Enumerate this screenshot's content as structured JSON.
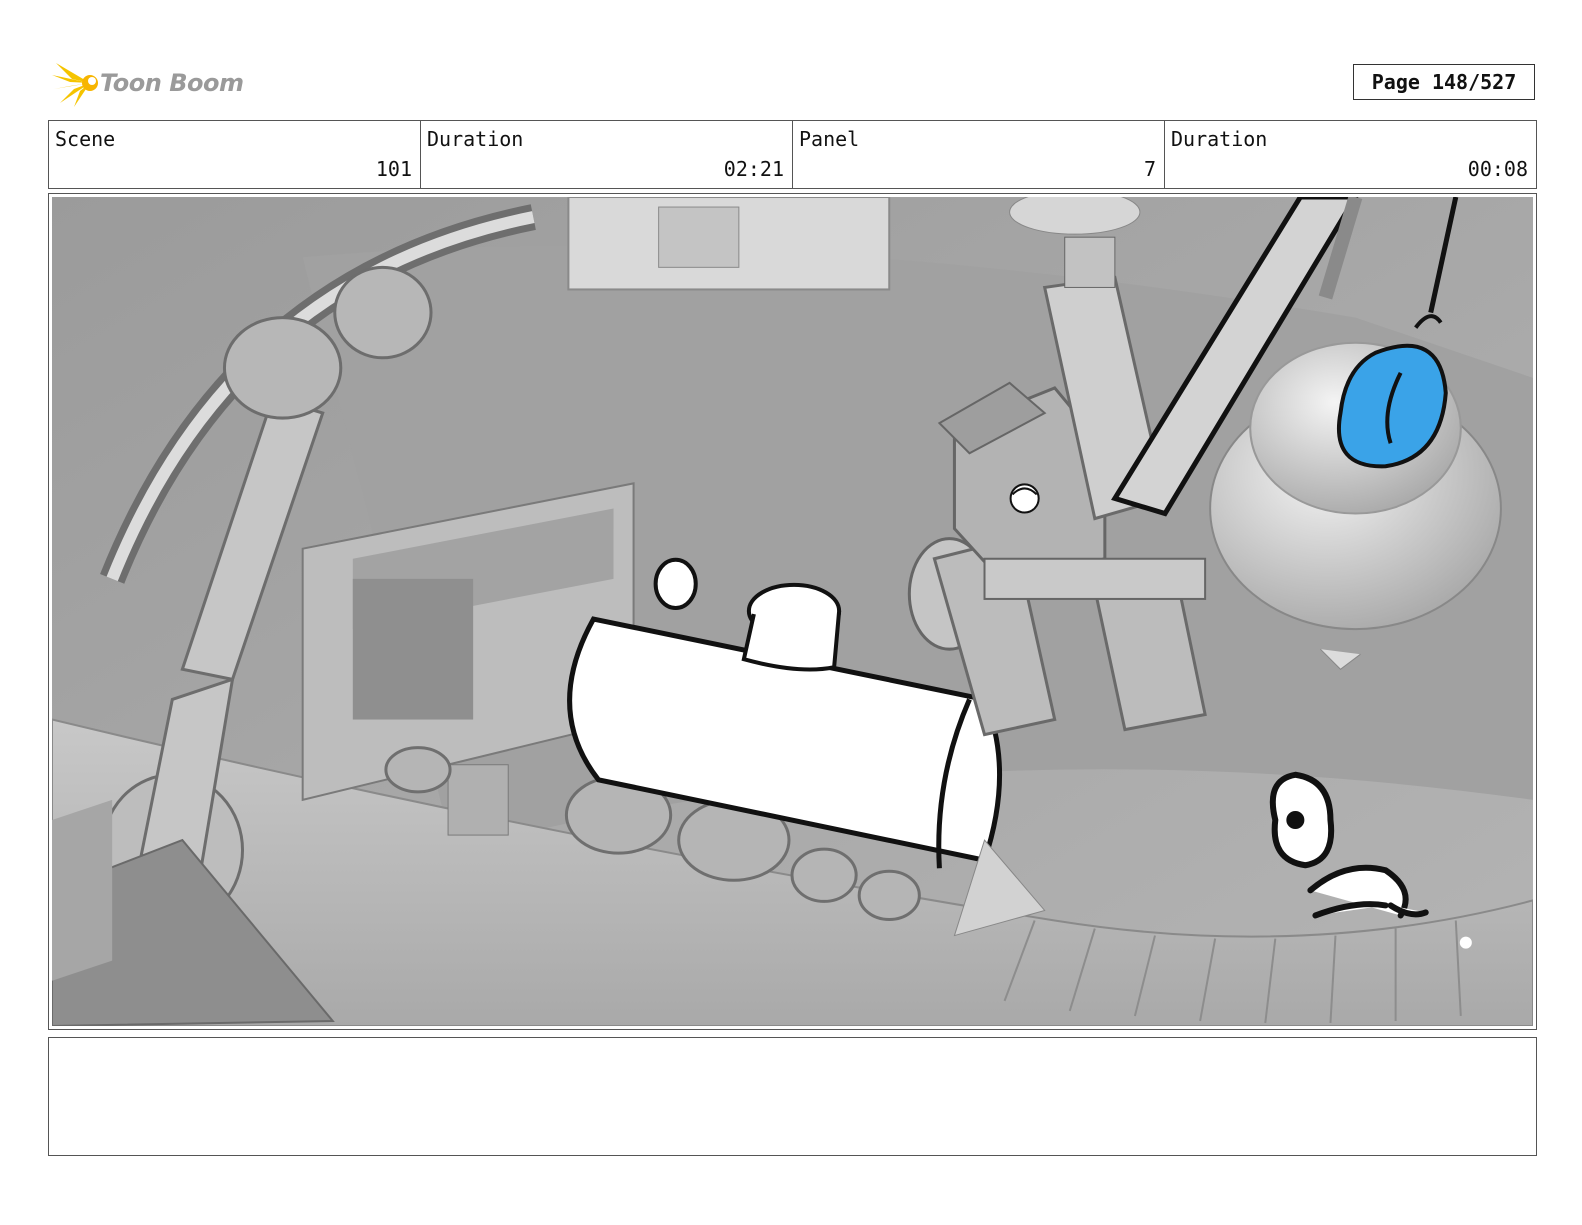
{
  "logo": {
    "text": "Toon Boom",
    "icon": "toon-boom-starburst-icon",
    "text_color": "#9a9a9a",
    "icon_color": "#f5c400"
  },
  "page_indicator": "Page 148/527",
  "info": {
    "scene_label": "Scene",
    "scene_value": "101",
    "scene_duration_label": "Duration",
    "scene_duration_value": "02:21",
    "panel_label": "Panel",
    "panel_value": "7",
    "panel_duration_label": "Duration",
    "panel_duration_value": "00:08"
  },
  "panel_image": {
    "accent_color": "#3aa3e8"
  },
  "notes": ""
}
